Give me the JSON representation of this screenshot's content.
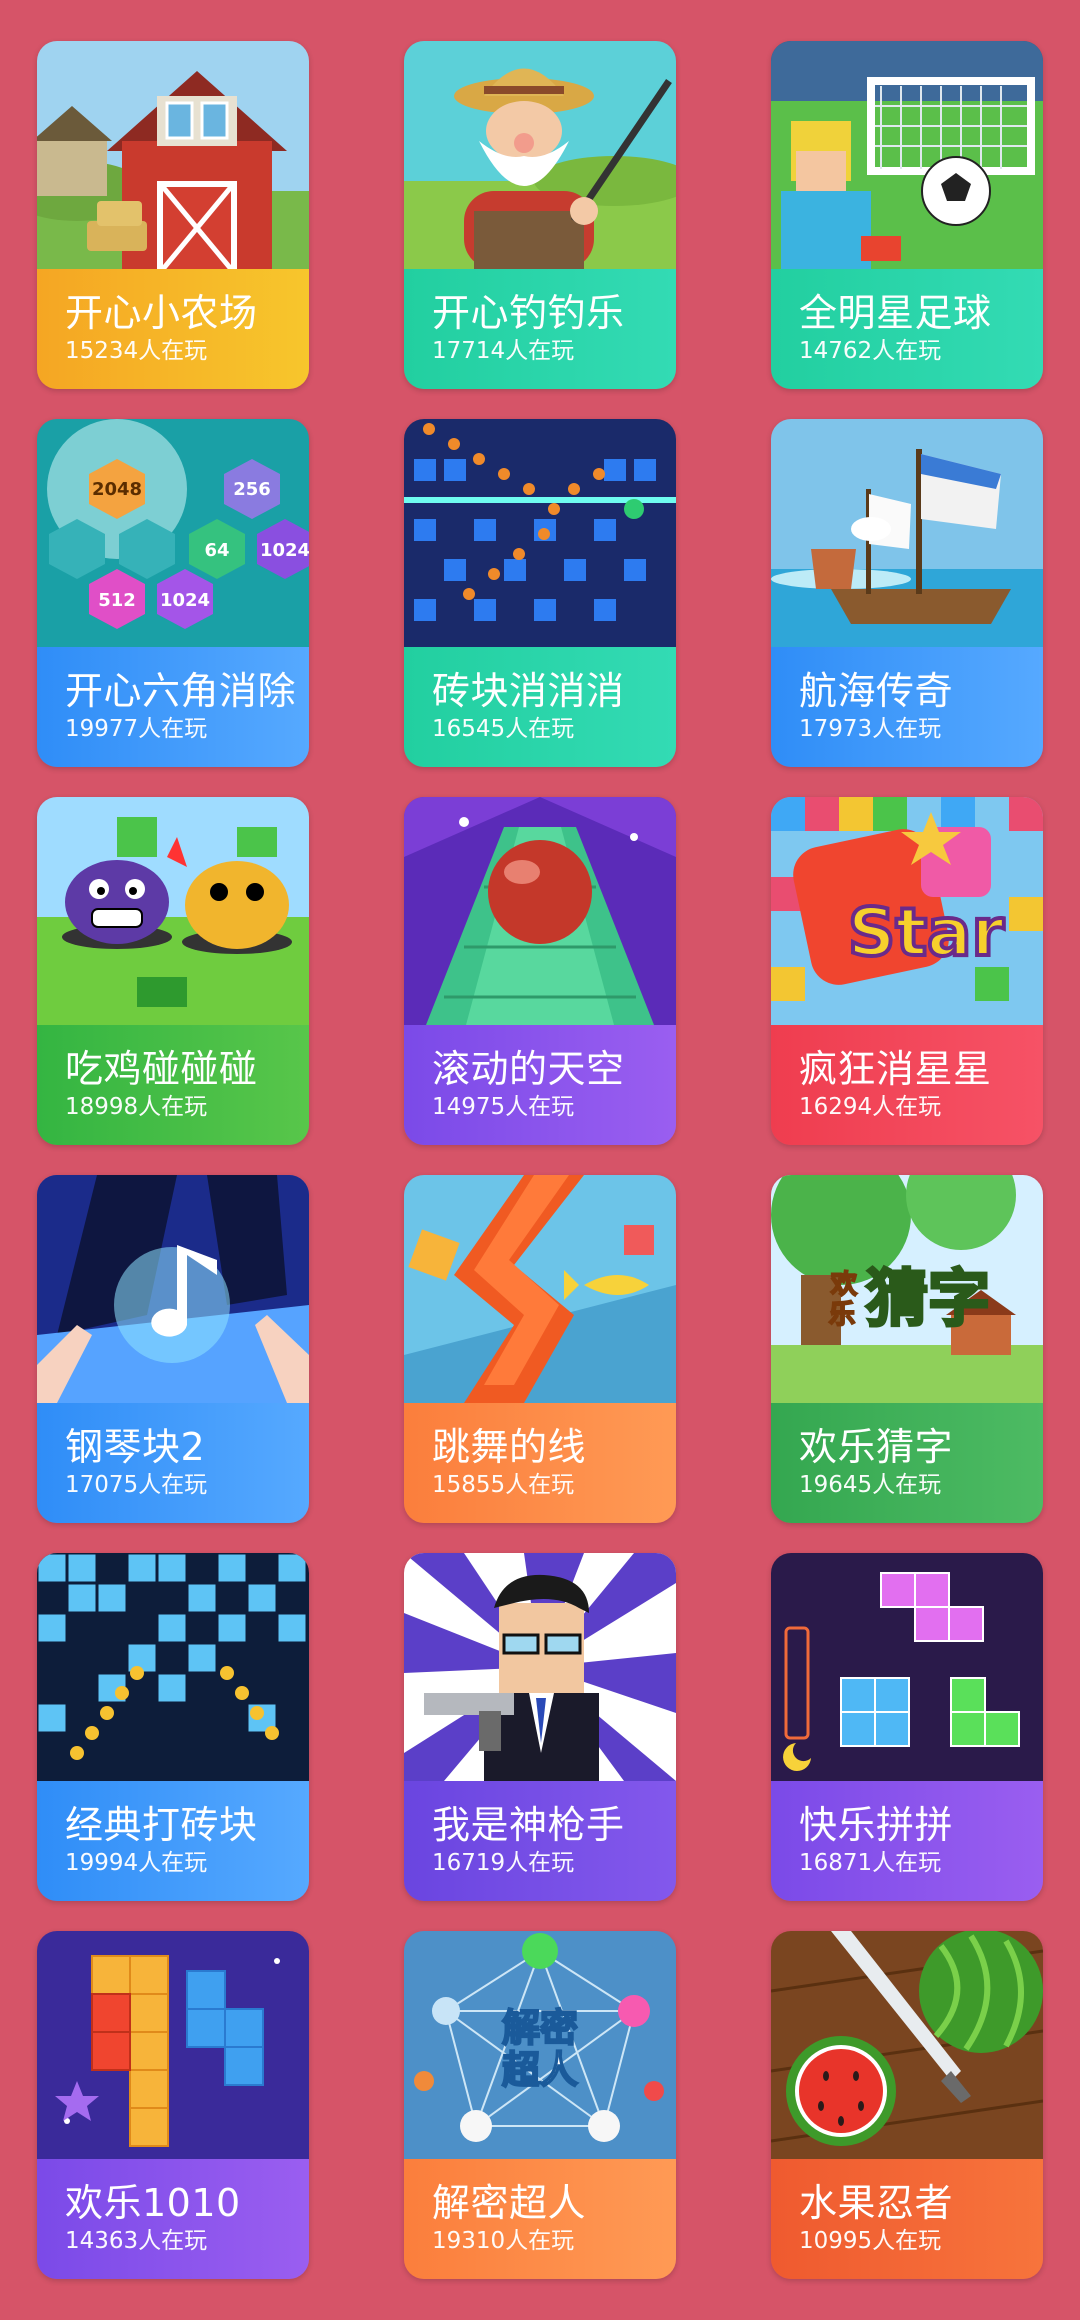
{
  "games": [
    {
      "title": "开心小农场",
      "players": "15234人在玩",
      "icon": "farm-barn-icon",
      "accent": "#f5a623",
      "accent2": "#f7c62c"
    },
    {
      "title": "开心钓钓乐",
      "players": "17714人在玩",
      "icon": "fisherman-icon",
      "accent": "#22cfa0",
      "accent2": "#33dbb4"
    },
    {
      "title": "全明星足球",
      "players": "14762人在玩",
      "icon": "soccer-goal-icon",
      "accent": "#22cfa0",
      "accent2": "#33dbb4"
    },
    {
      "title": "开心六角消除",
      "players": "19977人在玩",
      "icon": "hexagon-2048-icon",
      "accent": "#2f8df7",
      "accent2": "#56a9ff"
    },
    {
      "title": "砖块消消消",
      "players": "16545人在玩",
      "icon": "brick-breaker-icon",
      "accent": "#22cfa0",
      "accent2": "#33dbb4"
    },
    {
      "title": "航海传奇",
      "players": "17973人在玩",
      "icon": "pirate-ship-icon",
      "accent": "#2f8df7",
      "accent2": "#56a9ff"
    },
    {
      "title": "吃鸡碰碰碰",
      "players": "18998人在玩",
      "icon": "bumper-blobs-icon",
      "accent": "#34b542",
      "accent2": "#58c64a"
    },
    {
      "title": "滚动的天空",
      "players": "14975人在玩",
      "icon": "rolling-ball-icon",
      "accent": "#7b4ae8",
      "accent2": "#9a5ef0"
    },
    {
      "title": "疯狂消星星",
      "players": "16294人在玩",
      "icon": "pop-star-icon",
      "accent": "#ef3d4f",
      "accent2": "#f65266"
    },
    {
      "title": "钢琴块2",
      "players": "17075人在玩",
      "icon": "piano-tiles-icon",
      "accent": "#2f8df7",
      "accent2": "#56a9ff"
    },
    {
      "title": "跳舞的线",
      "players": "15855人在玩",
      "icon": "dancing-line-icon",
      "accent": "#fb7e3c",
      "accent2": "#ff9a55"
    },
    {
      "title": "欢乐猜字",
      "players": "19645人在玩",
      "icon": "guess-word-icon",
      "accent": "#34a750",
      "accent2": "#4dbb63"
    },
    {
      "title": "经典打砖块",
      "players": "19994人在玩",
      "icon": "classic-bricks-icon",
      "accent": "#2f8df7",
      "accent2": "#56a9ff"
    },
    {
      "title": "我是神枪手",
      "players": "16719人在玩",
      "icon": "gunman-icon",
      "accent": "#6a45e0",
      "accent2": "#8358ec"
    },
    {
      "title": "快乐拼拼",
      "players": "16871人在玩",
      "icon": "neon-blocks-icon",
      "accent": "#7b4ae8",
      "accent2": "#9a5ef0"
    },
    {
      "title": "欢乐1010",
      "players": "14363人在玩",
      "icon": "block-1010-icon",
      "accent": "#7b4ae8",
      "accent2": "#9a5ef0"
    },
    {
      "title": "解密超人",
      "players": "19310人在玩",
      "icon": "puzzle-network-icon",
      "accent": "#fb7e3c",
      "accent2": "#ff9a55"
    },
    {
      "title": "水果忍者",
      "players": "10995人在玩",
      "icon": "fruit-ninja-icon",
      "accent": "#ef5a2f",
      "accent2": "#f7743c"
    }
  ]
}
